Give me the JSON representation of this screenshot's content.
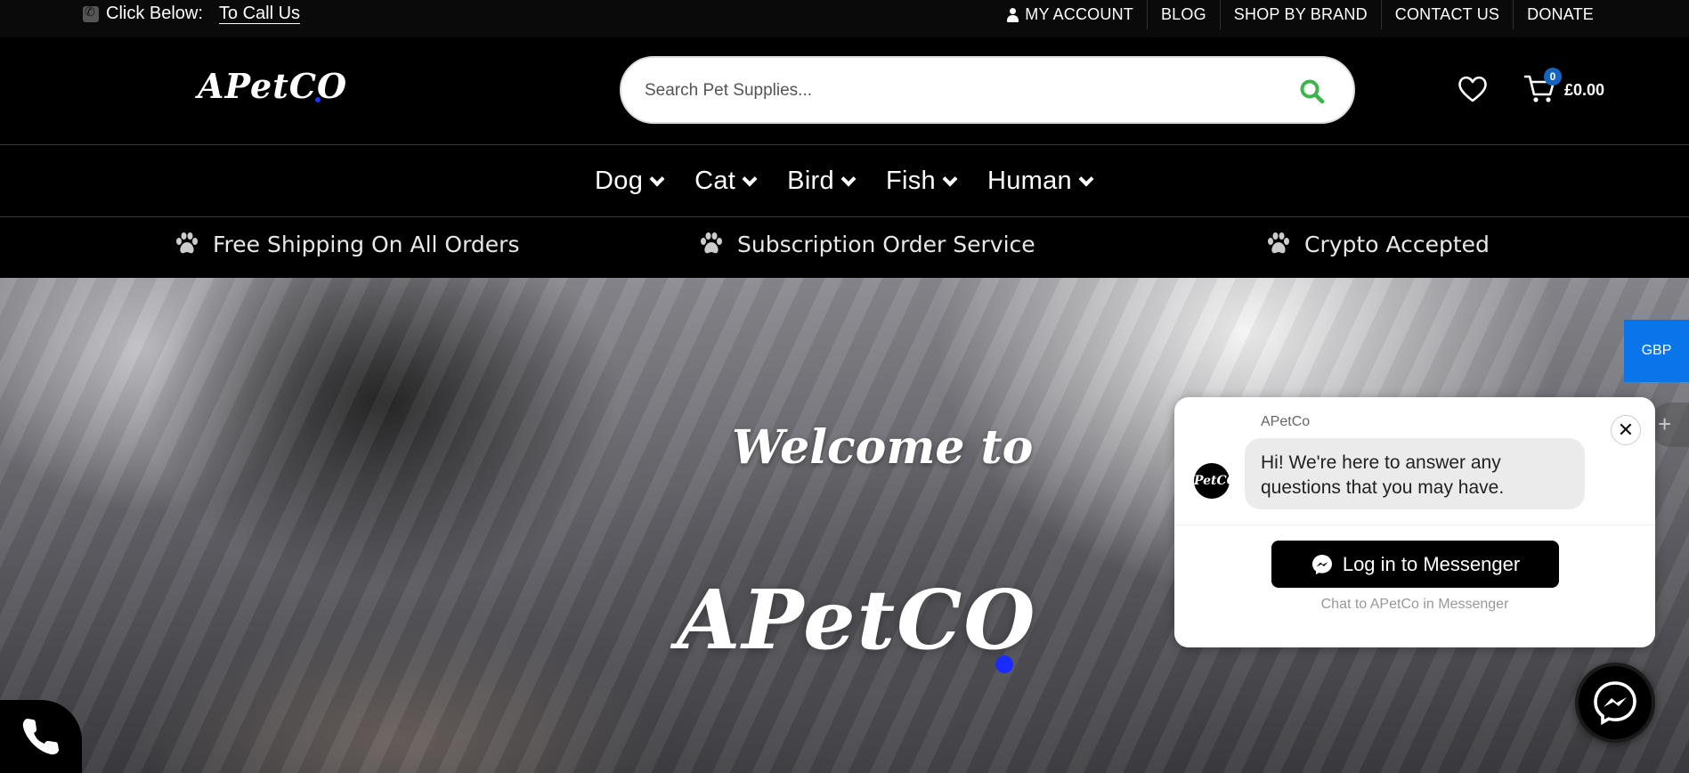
{
  "topbar": {
    "call_prefix": "Click Below:",
    "call_link": "To Call Us",
    "nav": [
      "MY ACCOUNT",
      "BLOG",
      "SHOP BY BRAND",
      "CONTACT US",
      "DONATE"
    ]
  },
  "header": {
    "logo": "APetCO",
    "search_placeholder": "Search Pet Supplies...",
    "cart_count": "0",
    "cart_total": "£0.00"
  },
  "mainnav": [
    "Dog",
    "Cat",
    "Bird",
    "Fish",
    "Human"
  ],
  "features": [
    "Free Shipping On All Orders",
    "Subscription Order Service",
    "Crypto Accepted"
  ],
  "hero": {
    "welcome": "Welcome to",
    "logo": "APetCO"
  },
  "currency": "GBP",
  "messenger": {
    "page_name": "APetCo",
    "avatar_text": "PetCO",
    "greeting": "Hi! We're here to answer any questions that you may have.",
    "login_label": "Log in to Messenger",
    "chat_to": "Chat to APetCo in Messenger"
  },
  "colors": {
    "accent_blue": "#1a2bff",
    "search_green": "#3cb54a",
    "currency_bg": "#0a75e8"
  }
}
